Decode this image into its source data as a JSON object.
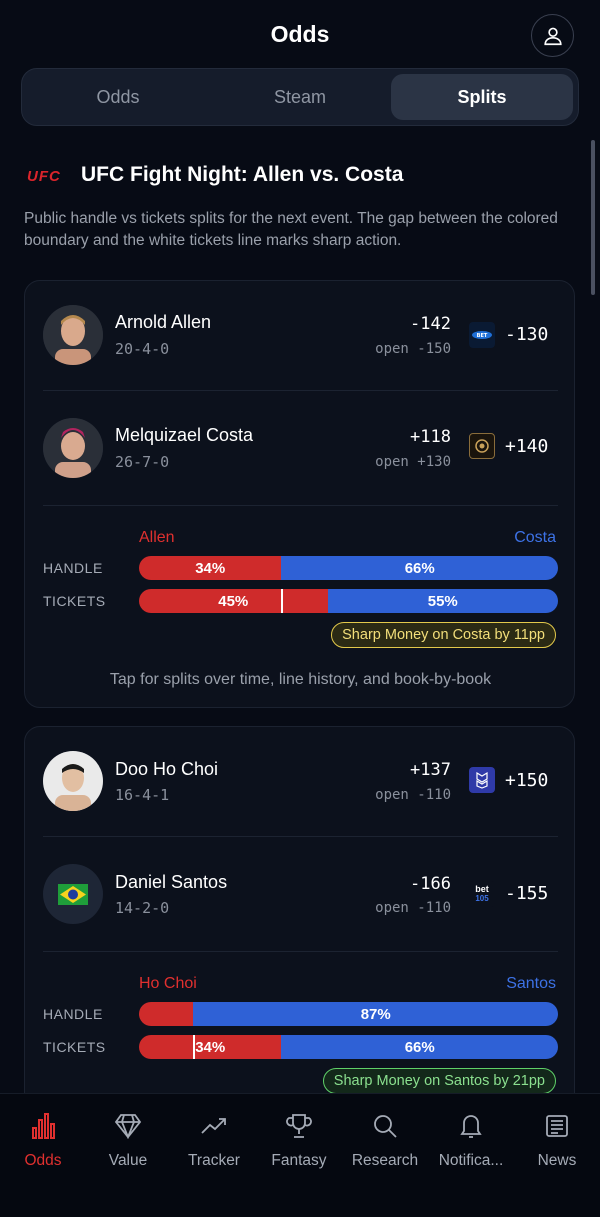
{
  "header": {
    "title": "Odds"
  },
  "tabs": [
    {
      "label": "Odds"
    },
    {
      "label": "Steam"
    },
    {
      "label": "Splits"
    }
  ],
  "event": {
    "logo": "UFC",
    "title": "UFC Fight Night: Allen vs. Costa",
    "description": "Public handle vs tickets splits for the next event. The gap between the colored boundary and the white tickets line marks sharp action."
  },
  "fights": [
    {
      "fighters": [
        {
          "name": "Arnold Allen",
          "record": "20-4-0",
          "odds": "-142",
          "open": "open -150",
          "book_odds": "-130",
          "book_icon": "bet-book-icon"
        },
        {
          "name": "Melquizael Costa",
          "record": "26-7-0",
          "odds": "+118",
          "open": "open +130",
          "book_odds": "+140",
          "book_icon": "lion-book-icon"
        }
      ],
      "splits": {
        "left_name": "Allen",
        "right_name": "Costa",
        "handle_label": "HANDLE",
        "tickets_label": "TICKETS",
        "handle_left": "34%",
        "handle_right": "66%",
        "tickets_left": "45%",
        "tickets_right": "55%",
        "handle_left_pct": 34,
        "tickets_left_pct": 45,
        "sharp_text": "Sharp Money on Costa by 11pp",
        "sharp_color": "#e3c94b"
      },
      "tap_hint": "Tap for splits over time, line history, and book-by-book"
    },
    {
      "fighters": [
        {
          "name": "Doo Ho Choi",
          "record": "16-4-1",
          "odds": "+137",
          "open": "open -110",
          "book_odds": "+150",
          "book_icon": "blue-book-icon"
        },
        {
          "name": "Daniel Santos",
          "record": "14-2-0",
          "odds": "-166",
          "open": "open -110",
          "book_odds": "-155",
          "book_icon": "bet105-book-icon"
        }
      ],
      "splits": {
        "left_name": "Ho Choi",
        "right_name": "Santos",
        "handle_label": "HANDLE",
        "tickets_label": "TICKETS",
        "handle_left": "",
        "handle_right": "87%",
        "tickets_left": "34%",
        "tickets_right": "66%",
        "handle_left_pct": 13,
        "tickets_left_pct": 34,
        "sharp_text": "Sharp Money on Santos by 21pp",
        "sharp_color": "#5fd068"
      }
    }
  ],
  "bet105_text": "bet 105",
  "nav": [
    {
      "label": "Odds",
      "icon": "bar-chart-icon",
      "active": true
    },
    {
      "label": "Value",
      "icon": "diamond-icon"
    },
    {
      "label": "Tracker",
      "icon": "trending-up-icon"
    },
    {
      "label": "Fantasy",
      "icon": "trophy-icon"
    },
    {
      "label": "Research",
      "icon": "search-icon"
    },
    {
      "label": "Notifica...",
      "icon": "bell-icon"
    },
    {
      "label": "News",
      "icon": "newspaper-icon"
    }
  ],
  "colors": {
    "accent": "#e0302f",
    "red": "#cf2b2b",
    "blue": "#2f61d6",
    "left_name": "#e0302f",
    "right_name": "#3d72e6"
  }
}
